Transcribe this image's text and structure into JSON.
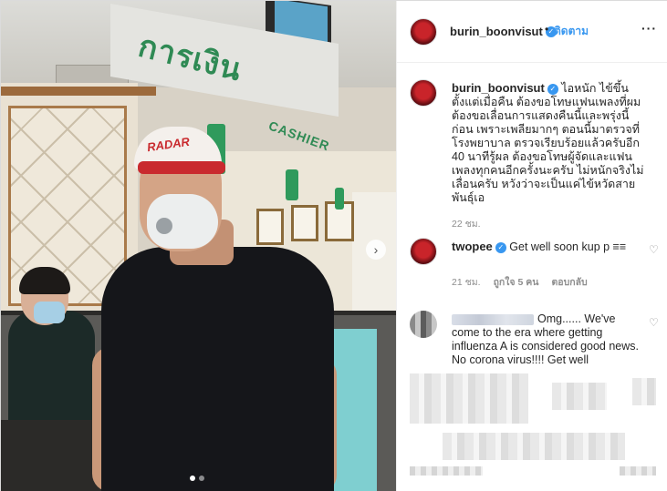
{
  "post": {
    "image_alt": "",
    "carousel_page": 1,
    "carousel_total": 2
  },
  "header": {
    "username": "burin_boonvisut",
    "follow_label": "ติดตาม",
    "separator": "•",
    "more_label": "···"
  },
  "caption": {
    "username": "burin_boonvisut",
    "text": "ไอหนัก ไข้ขึ้นตั้งแต่เมื่อคืน ต้องขอโทษแฟนเพลงที่ผมต้องขอเลื่อนการแสดงคืนนี้และพรุ่งนี้ก่อน เพราะเพลียมากๆ ตอนนี้มาตรวจที่โรงพยาบาล ตรวจเรียบร้อยแล้วครับอีก 40 นาทีรู้ผล ต้องขอโทษผู้จัดและแฟนเพลงทุกคนอีกครั้งนะครับ ไม่หนักจริงไม่เลื่อนครับ หวังว่าจะเป็นแค่ไข้หวัดสายพันธุ์เอ",
    "time": "22 ชม."
  },
  "comments": [
    {
      "username": "twopee",
      "verified": true,
      "text": "Get well soon kup p ≡≡",
      "time": "21 ชม.",
      "likes": "ถูกใจ 5 คน",
      "reply": "ตอบกลับ"
    },
    {
      "username": "",
      "verified": false,
      "text": "Omg...... We've come to the era where getting influenza A is considered good news. No corona virus!!!! Get well",
      "time": "",
      "likes": "",
      "reply": ""
    }
  ],
  "colors": {
    "link_blue": "#3897f0",
    "text": "#262626",
    "muted": "#8e8e8e",
    "border": "#efefef"
  },
  "icons": {
    "verified": "verified-badge-icon",
    "heart": "heart-outline-icon",
    "more": "more-horizontal-icon",
    "next": "chevron-right-icon"
  }
}
